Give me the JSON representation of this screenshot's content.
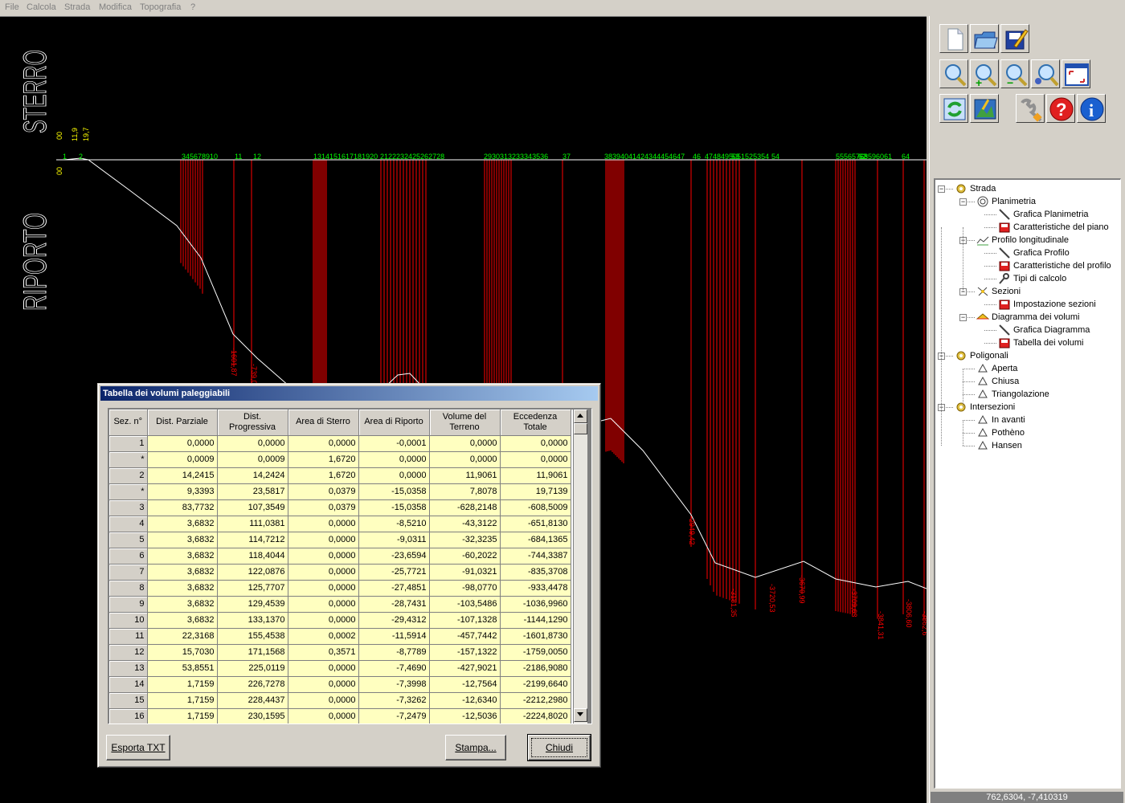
{
  "menu": [
    "File",
    "Calcola",
    "Strada",
    "Modifica",
    "Topografia",
    "?"
  ],
  "canvas": {
    "label_sterro": "STERRO",
    "label_riporto": "RIPORTO",
    "top_small_labels": [
      "00",
      "11,9",
      "19,7"
    ],
    "left_small_label": "00",
    "station_labels": [
      "1",
      "2",
      "345678910",
      "11",
      "12",
      "1314151617181920",
      "2122232425262728",
      "2930313233343536",
      "37",
      "38394041424344454647",
      "46",
      "4748495051525354",
      "53",
      "54",
      "55565758596061",
      "62",
      "63",
      "64"
    ],
    "fill_labels": [
      "-1601,87",
      "-739,01",
      "-2949,42",
      "-3181,35",
      "-3720,53",
      "-3670,99",
      "-3709,63",
      "-3841,31",
      "-3806,60",
      "-3862,6"
    ],
    "colors": {
      "ground": "#ffffff",
      "sections": "#ff0000",
      "stations": "#00ff00",
      "top_labels": "#ffff00"
    }
  },
  "toolbar": {
    "rows": [
      [
        "new-file-icon",
        "open-folder-icon",
        "save-edit-icon"
      ],
      [
        "zoom-icon",
        "zoom-in-icon",
        "zoom-out-icon",
        "zoom-window-icon",
        "fit-window-icon"
      ],
      [
        "refresh-icon",
        "image-chart-icon",
        "settings-wrench-icon",
        "help-icon",
        "info-icon"
      ]
    ]
  },
  "tree": [
    {
      "label": "Strada",
      "level": 0,
      "icon": "gear-icon",
      "toggle": "−"
    },
    {
      "label": "Planimetria",
      "level": 1,
      "icon": "spiral-icon",
      "toggle": "−"
    },
    {
      "label": "Grafica Planimetria",
      "level": 2,
      "icon": "pencil-icon"
    },
    {
      "label": "Caratteristiche del piano",
      "level": 2,
      "icon": "book-icon"
    },
    {
      "label": "Profilo longitudinale",
      "level": 1,
      "icon": "profile-icon",
      "toggle": "−"
    },
    {
      "label": "Grafica Profilo",
      "level": 2,
      "icon": "pencil-icon"
    },
    {
      "label": "Caratteristiche del profilo",
      "level": 2,
      "icon": "book-icon"
    },
    {
      "label": "Tipi di calcolo",
      "level": 2,
      "icon": "wrench-icon"
    },
    {
      "label": "Sezioni",
      "level": 1,
      "icon": "section-icon",
      "toggle": "−"
    },
    {
      "label": "Impostazione sezioni",
      "level": 2,
      "icon": "book-icon"
    },
    {
      "label": "Diagramma dei volumi",
      "level": 1,
      "icon": "diagram-icon",
      "toggle": "−"
    },
    {
      "label": "Grafica Diagramma",
      "level": 2,
      "icon": "pencil-icon"
    },
    {
      "label": "Tabella dei volumi",
      "level": 2,
      "icon": "book-icon"
    },
    {
      "label": "Poligonali",
      "level": 0,
      "icon": "gear-icon",
      "toggle": "−"
    },
    {
      "label": "Aperta",
      "level": 1,
      "icon": "open-polygon-icon"
    },
    {
      "label": "Chiusa",
      "level": 1,
      "icon": "closed-polygon-icon"
    },
    {
      "label": "Triangolazione",
      "level": 1,
      "icon": "triangulation-icon"
    },
    {
      "label": "Intersezioni",
      "level": 0,
      "icon": "gear-icon",
      "toggle": "−"
    },
    {
      "label": "In avanti",
      "level": 1,
      "icon": "forward-icon"
    },
    {
      "label": "Pothèno",
      "level": 1,
      "icon": "pothenot-icon"
    },
    {
      "label": "Hansen",
      "level": 1,
      "icon": "hansen-icon"
    }
  ],
  "status": "762,6304, -7,410319",
  "dialog": {
    "title": "Tabella dei volumi paleggiabili",
    "headers": [
      "Sez. n°",
      "Dist. Parziale",
      "Dist. Progressiva",
      "Area di Sterro",
      "Area di Riporto",
      "Volume del Terreno",
      "Eccedenza Totale"
    ],
    "rows": [
      [
        "1",
        "0,0000",
        "0,0000",
        "0,0000",
        "-0,0001",
        "0,0000",
        "0,0000"
      ],
      [
        "*",
        "0,0009",
        "0,0009",
        "1,6720",
        "0,0000",
        "0,0000",
        "0,0000"
      ],
      [
        "2",
        "14,2415",
        "14,2424",
        "1,6720",
        "0,0000",
        "11,9061",
        "11,9061"
      ],
      [
        "*",
        "9,3393",
        "23,5817",
        "0,0379",
        "-15,0358",
        "7,8078",
        "19,7139"
      ],
      [
        "3",
        "83,7732",
        "107,3549",
        "0,0379",
        "-15,0358",
        "-628,2148",
        "-608,5009"
      ],
      [
        "4",
        "3,6832",
        "111,0381",
        "0,0000",
        "-8,5210",
        "-43,3122",
        "-651,8130"
      ],
      [
        "5",
        "3,6832",
        "114,7212",
        "0,0000",
        "-9,0311",
        "-32,3235",
        "-684,1365"
      ],
      [
        "6",
        "3,6832",
        "118,4044",
        "0,0000",
        "-23,6594",
        "-60,2022",
        "-744,3387"
      ],
      [
        "7",
        "3,6832",
        "122,0876",
        "0,0000",
        "-25,7721",
        "-91,0321",
        "-835,3708"
      ],
      [
        "8",
        "3,6832",
        "125,7707",
        "0,0000",
        "-27,4851",
        "-98,0770",
        "-933,4478"
      ],
      [
        "9",
        "3,6832",
        "129,4539",
        "0,0000",
        "-28,7431",
        "-103,5486",
        "-1036,9960"
      ],
      [
        "10",
        "3,6832",
        "133,1370",
        "0,0000",
        "-29,4312",
        "-107,1328",
        "-1144,1290"
      ],
      [
        "11",
        "22,3168",
        "155,4538",
        "0,0002",
        "-11,5914",
        "-457,7442",
        "-1601,8730"
      ],
      [
        "12",
        "15,7030",
        "171,1568",
        "0,3571",
        "-8,7789",
        "-157,1322",
        "-1759,0050"
      ],
      [
        "13",
        "53,8551",
        "225,0119",
        "0,0000",
        "-7,4690",
        "-427,9021",
        "-2186,9080"
      ],
      [
        "14",
        "1,7159",
        "226,7278",
        "0,0000",
        "-7,3998",
        "-12,7564",
        "-2199,6640"
      ],
      [
        "15",
        "1,7159",
        "228,4437",
        "0,0000",
        "-7,3262",
        "-12,6340",
        "-2212,2980"
      ],
      [
        "16",
        "1,7159",
        "230,1595",
        "0,0000",
        "-7,2479",
        "-12,5036",
        "-2224,8020"
      ]
    ],
    "buttons": {
      "export": "Esporta TXT",
      "print": "Stampa...",
      "close": "Chiudi"
    }
  }
}
